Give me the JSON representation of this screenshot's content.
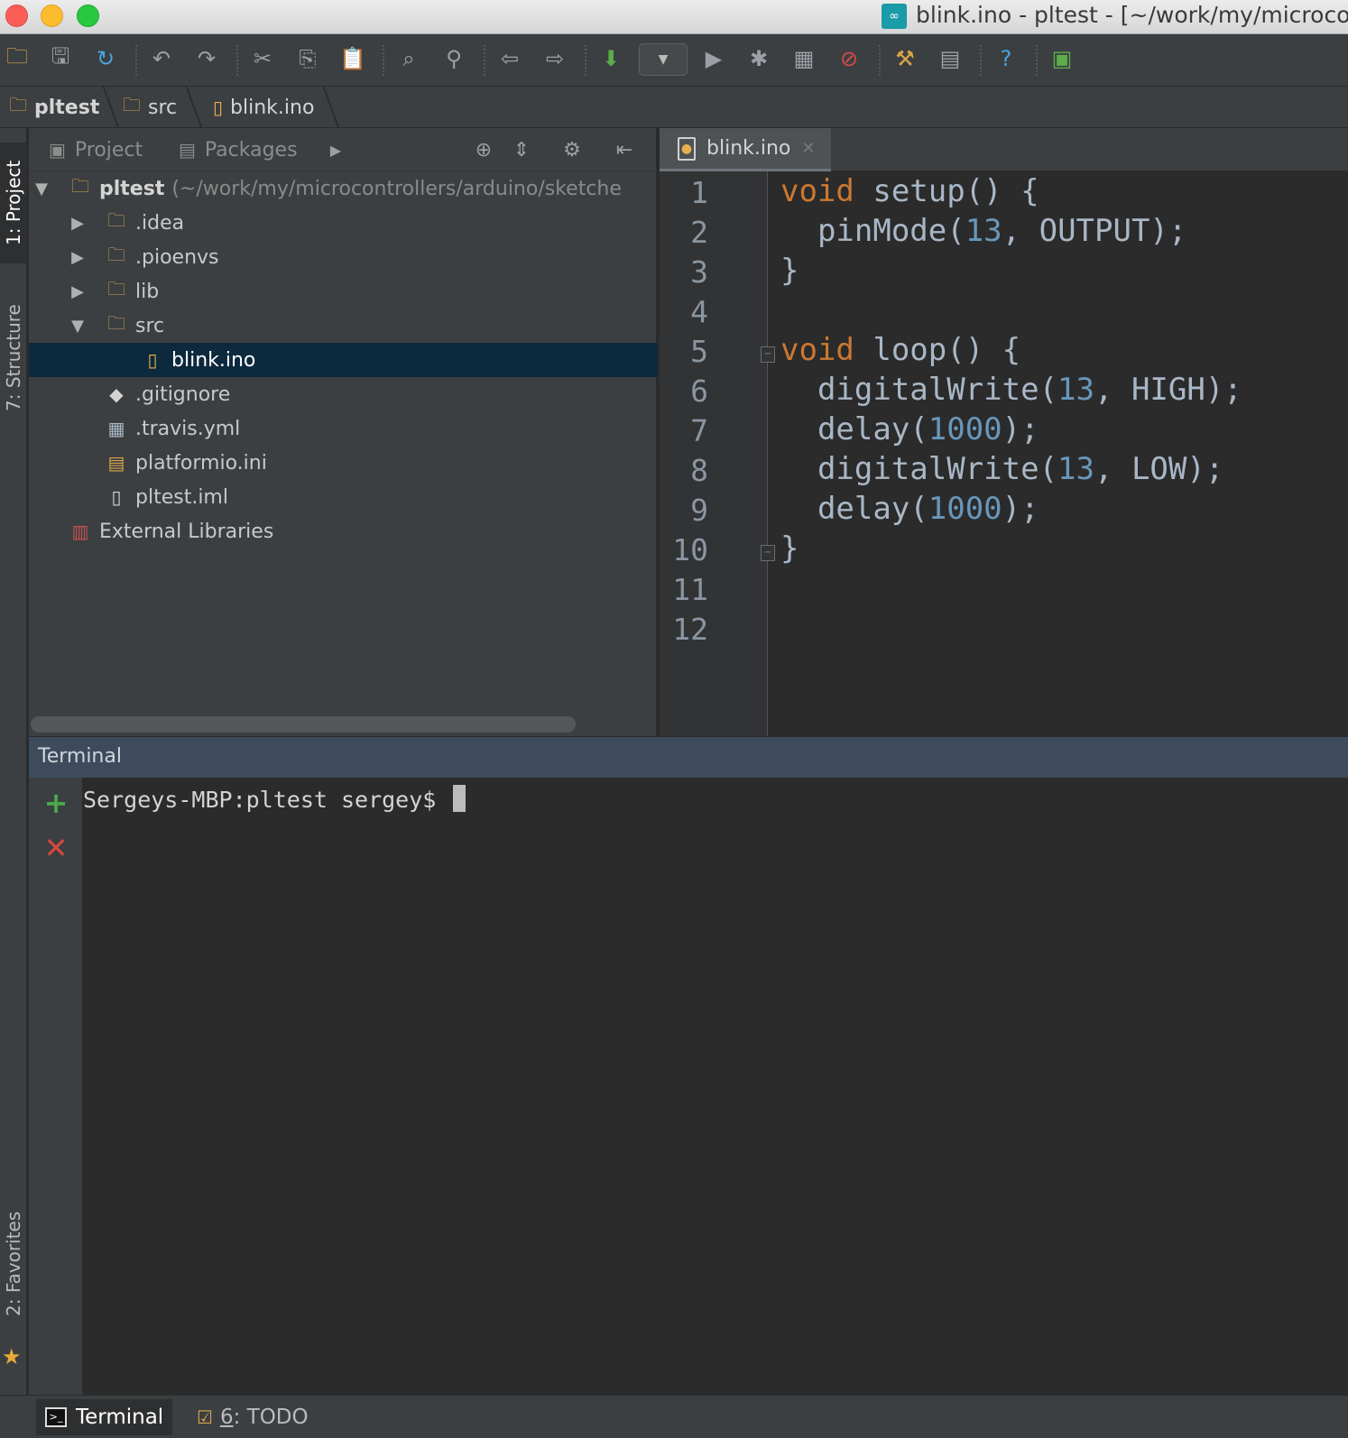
{
  "window": {
    "title": "blink.ino - pltest - [~/work/my/microcon"
  },
  "breadcrumb": [
    {
      "label": "pltest"
    },
    {
      "label": "src"
    },
    {
      "label": "blink.ino"
    }
  ],
  "left_strip": {
    "project_tab": "1: Project",
    "structure_tab": "7: Structure",
    "favorites_tab": "2: Favorites"
  },
  "project_panel": {
    "tabs": [
      {
        "label": "Project"
      },
      {
        "label": "Packages"
      }
    ],
    "tree": [
      {
        "label": "pltest",
        "path": "(~/work/my/microcontrollers/arduino/sketche",
        "icon": "project-folder-icon",
        "expanded": true
      },
      {
        "label": ".idea",
        "icon": "folder-icon",
        "expanded": false
      },
      {
        "label": ".pioenvs",
        "icon": "folder-icon",
        "expanded": false
      },
      {
        "label": "lib",
        "icon": "folder-icon",
        "expanded": false
      },
      {
        "label": "src",
        "icon": "folder-icon",
        "expanded": true
      },
      {
        "label": "blink.ino",
        "icon": "arduino-file-icon",
        "selected": true
      },
      {
        "label": ".gitignore",
        "icon": "git-file-icon"
      },
      {
        "label": ".travis.yml",
        "icon": "yaml-file-icon"
      },
      {
        "label": "platformio.ini",
        "icon": "ini-file-icon"
      },
      {
        "label": "pltest.iml",
        "icon": "iml-file-icon"
      },
      {
        "label": "External Libraries",
        "icon": "libraries-icon"
      }
    ]
  },
  "editor": {
    "tab_label": "blink.ino",
    "line_numbers": [
      "1",
      "2",
      "3",
      "4",
      "5",
      "6",
      "7",
      "8",
      "9",
      "10",
      "11",
      "12"
    ],
    "code": {
      "l1_kw": "void",
      "l1_rest": " setup() {",
      "l2_a": "  pinMode(",
      "l2_num": "13",
      "l2_b": ", OUTPUT);",
      "l3": "}",
      "l5_kw": "void",
      "l5_rest": " loop() {",
      "l6_a": "  digitalWrite(",
      "l6_num": "13",
      "l6_b": ", HIGH);",
      "l7_a": "  delay(",
      "l7_num": "1000",
      "l7_b": ");",
      "l8_a": "  digitalWrite(",
      "l8_num": "13",
      "l8_b": ", LOW);",
      "l9_a": "  delay(",
      "l9_num": "1000",
      "l9_b": ");",
      "l10": "}"
    }
  },
  "terminal": {
    "title": "Terminal",
    "prompt": "Sergeys-MBP:pltest sergey$ "
  },
  "bottom_tabs": {
    "terminal": "Terminal",
    "todo_num": "6",
    "todo_rest": ": TODO"
  },
  "colors": {
    "keyword": "#cc7832",
    "number": "#6897bb",
    "selection": "#0d293e",
    "terminal_header": "#3d4b5c"
  }
}
